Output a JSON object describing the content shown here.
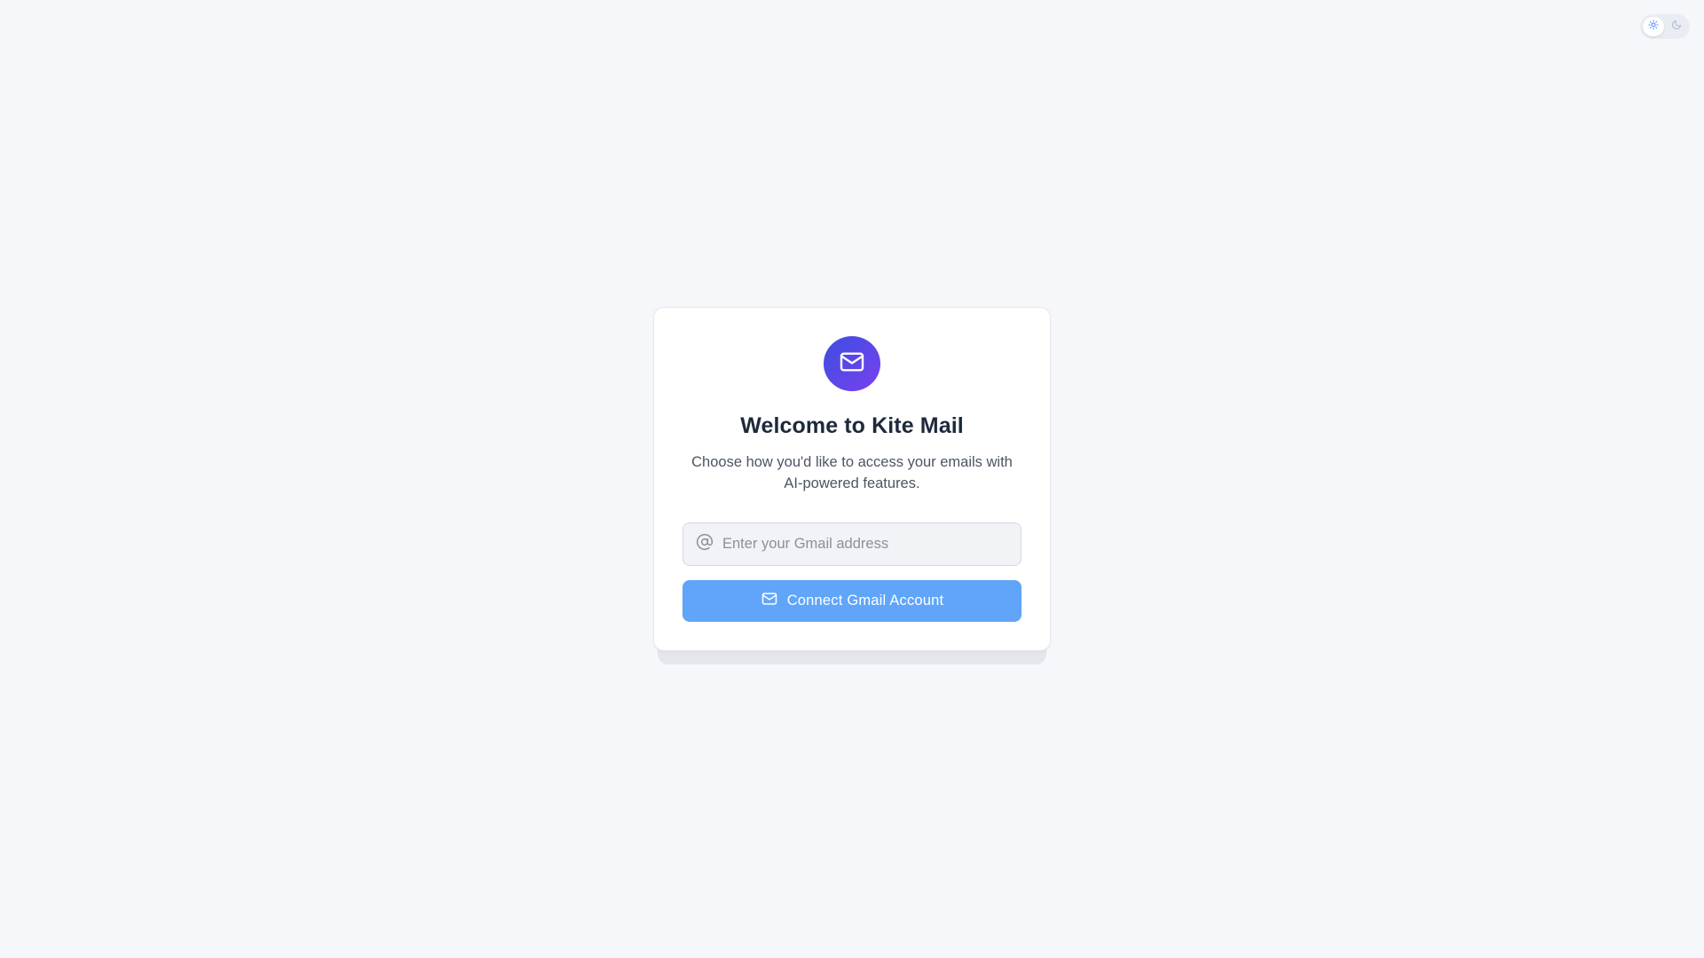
{
  "theme_toggle": {
    "options": [
      "sun-icon",
      "moon-icon"
    ],
    "active": "light"
  },
  "login_card": {
    "logo_icon": "mail-icon",
    "title": "Welcome to Kite Mail",
    "subtitle": "Choose how you'd like to access your emails with AI-powered features.",
    "email_input": {
      "icon": "at-sign-icon",
      "placeholder": "Enter your Gmail address",
      "value": ""
    },
    "connect_button": {
      "icon": "mail-icon",
      "label": "Connect Gmail Account"
    }
  },
  "colors": {
    "background": "#f5f7fa",
    "accent_gradient_start": "#3b4fe0",
    "accent_gradient_end": "#7b3ff0",
    "button": "#60a5fa",
    "title": "#1e293b",
    "subtitle": "#4b5563"
  }
}
